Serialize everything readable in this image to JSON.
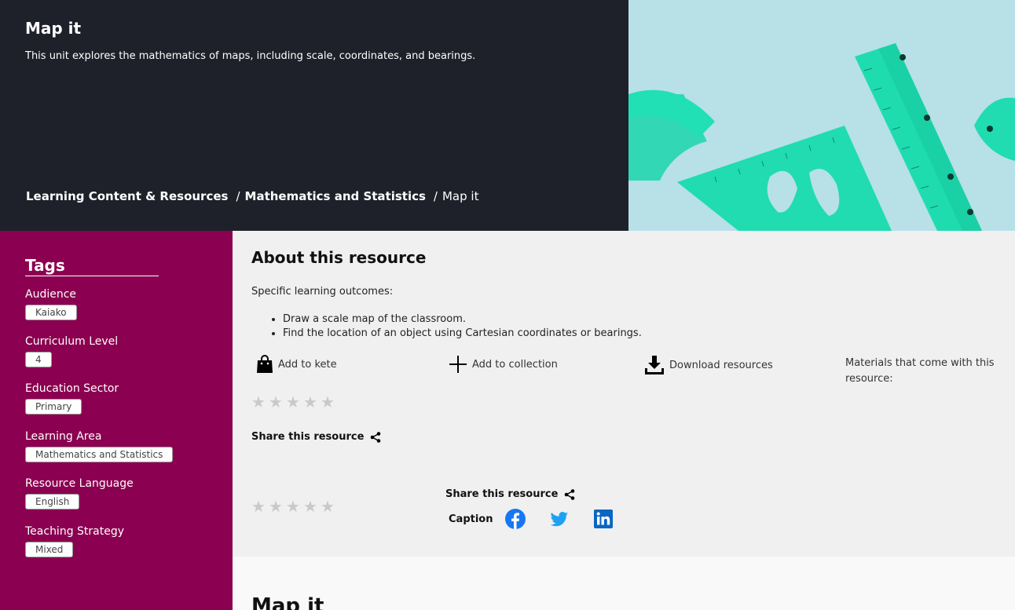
{
  "hero": {
    "title": "Map it",
    "description": "This unit explores the mathematics of maps, including scale, coordinates, and bearings.",
    "breadcrumb": {
      "items": [
        "Learning Content & Resources",
        "Mathematics and Statistics"
      ],
      "current": "Map it",
      "separator": "/"
    },
    "image_icon": "rulers-protractor-image"
  },
  "sidebar": {
    "title": "Tags",
    "groups": [
      {
        "label": "Audience",
        "value": "Kaiako"
      },
      {
        "label": "Curriculum Level",
        "value": "4"
      },
      {
        "label": "Education Sector",
        "value": "Primary"
      },
      {
        "label": "Learning Area",
        "value": "Mathematics and Statistics"
      },
      {
        "label": "Resource Language",
        "value": "English"
      },
      {
        "label": "Teaching Strategy",
        "value": "Mixed"
      }
    ]
  },
  "about": {
    "title": "About this resource",
    "outcomes_label": "Specific learning outcomes:",
    "outcomes": [
      "Draw a scale map of the classroom.",
      "Find the location of an object using Cartesian coordinates or bearings."
    ],
    "actions": {
      "add_kete": "Add to kete",
      "add_collection": "Add to collection",
      "download": "Download resources"
    },
    "materials": "Materials that come with this resource:",
    "share_label": "Share this resource",
    "caption": "Caption",
    "rating": 0
  },
  "bottom": {
    "title": "Map it"
  },
  "colors": {
    "hero_bg": "#1e212a",
    "sidebar_bg": "#8b0050",
    "main_bg": "#f0f0f0",
    "facebook": "#1877f2",
    "twitter": "#1da1f2",
    "linkedin": "#0a66c2"
  }
}
